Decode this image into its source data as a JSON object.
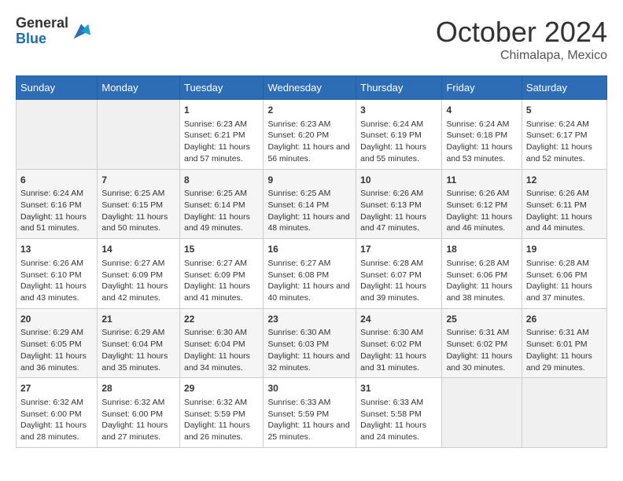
{
  "logo": {
    "general": "General",
    "blue": "Blue"
  },
  "title": "October 2024",
  "subtitle": "Chimalapa, Mexico",
  "days_of_week": [
    "Sunday",
    "Monday",
    "Tuesday",
    "Wednesday",
    "Thursday",
    "Friday",
    "Saturday"
  ],
  "weeks": [
    [
      {
        "day": "",
        "sunrise": "",
        "sunset": "",
        "daylight": ""
      },
      {
        "day": "",
        "sunrise": "",
        "sunset": "",
        "daylight": ""
      },
      {
        "day": "1",
        "sunrise": "Sunrise: 6:23 AM",
        "sunset": "Sunset: 6:21 PM",
        "daylight": "Daylight: 11 hours and 57 minutes."
      },
      {
        "day": "2",
        "sunrise": "Sunrise: 6:23 AM",
        "sunset": "Sunset: 6:20 PM",
        "daylight": "Daylight: 11 hours and 56 minutes."
      },
      {
        "day": "3",
        "sunrise": "Sunrise: 6:24 AM",
        "sunset": "Sunset: 6:19 PM",
        "daylight": "Daylight: 11 hours and 55 minutes."
      },
      {
        "day": "4",
        "sunrise": "Sunrise: 6:24 AM",
        "sunset": "Sunset: 6:18 PM",
        "daylight": "Daylight: 11 hours and 53 minutes."
      },
      {
        "day": "5",
        "sunrise": "Sunrise: 6:24 AM",
        "sunset": "Sunset: 6:17 PM",
        "daylight": "Daylight: 11 hours and 52 minutes."
      }
    ],
    [
      {
        "day": "6",
        "sunrise": "Sunrise: 6:24 AM",
        "sunset": "Sunset: 6:16 PM",
        "daylight": "Daylight: 11 hours and 51 minutes."
      },
      {
        "day": "7",
        "sunrise": "Sunrise: 6:25 AM",
        "sunset": "Sunset: 6:15 PM",
        "daylight": "Daylight: 11 hours and 50 minutes."
      },
      {
        "day": "8",
        "sunrise": "Sunrise: 6:25 AM",
        "sunset": "Sunset: 6:14 PM",
        "daylight": "Daylight: 11 hours and 49 minutes."
      },
      {
        "day": "9",
        "sunrise": "Sunrise: 6:25 AM",
        "sunset": "Sunset: 6:14 PM",
        "daylight": "Daylight: 11 hours and 48 minutes."
      },
      {
        "day": "10",
        "sunrise": "Sunrise: 6:26 AM",
        "sunset": "Sunset: 6:13 PM",
        "daylight": "Daylight: 11 hours and 47 minutes."
      },
      {
        "day": "11",
        "sunrise": "Sunrise: 6:26 AM",
        "sunset": "Sunset: 6:12 PM",
        "daylight": "Daylight: 11 hours and 46 minutes."
      },
      {
        "day": "12",
        "sunrise": "Sunrise: 6:26 AM",
        "sunset": "Sunset: 6:11 PM",
        "daylight": "Daylight: 11 hours and 44 minutes."
      }
    ],
    [
      {
        "day": "13",
        "sunrise": "Sunrise: 6:26 AM",
        "sunset": "Sunset: 6:10 PM",
        "daylight": "Daylight: 11 hours and 43 minutes."
      },
      {
        "day": "14",
        "sunrise": "Sunrise: 6:27 AM",
        "sunset": "Sunset: 6:09 PM",
        "daylight": "Daylight: 11 hours and 42 minutes."
      },
      {
        "day": "15",
        "sunrise": "Sunrise: 6:27 AM",
        "sunset": "Sunset: 6:09 PM",
        "daylight": "Daylight: 11 hours and 41 minutes."
      },
      {
        "day": "16",
        "sunrise": "Sunrise: 6:27 AM",
        "sunset": "Sunset: 6:08 PM",
        "daylight": "Daylight: 11 hours and 40 minutes."
      },
      {
        "day": "17",
        "sunrise": "Sunrise: 6:28 AM",
        "sunset": "Sunset: 6:07 PM",
        "daylight": "Daylight: 11 hours and 39 minutes."
      },
      {
        "day": "18",
        "sunrise": "Sunrise: 6:28 AM",
        "sunset": "Sunset: 6:06 PM",
        "daylight": "Daylight: 11 hours and 38 minutes."
      },
      {
        "day": "19",
        "sunrise": "Sunrise: 6:28 AM",
        "sunset": "Sunset: 6:06 PM",
        "daylight": "Daylight: 11 hours and 37 minutes."
      }
    ],
    [
      {
        "day": "20",
        "sunrise": "Sunrise: 6:29 AM",
        "sunset": "Sunset: 6:05 PM",
        "daylight": "Daylight: 11 hours and 36 minutes."
      },
      {
        "day": "21",
        "sunrise": "Sunrise: 6:29 AM",
        "sunset": "Sunset: 6:04 PM",
        "daylight": "Daylight: 11 hours and 35 minutes."
      },
      {
        "day": "22",
        "sunrise": "Sunrise: 6:30 AM",
        "sunset": "Sunset: 6:04 PM",
        "daylight": "Daylight: 11 hours and 34 minutes."
      },
      {
        "day": "23",
        "sunrise": "Sunrise: 6:30 AM",
        "sunset": "Sunset: 6:03 PM",
        "daylight": "Daylight: 11 hours and 32 minutes."
      },
      {
        "day": "24",
        "sunrise": "Sunrise: 6:30 AM",
        "sunset": "Sunset: 6:02 PM",
        "daylight": "Daylight: 11 hours and 31 minutes."
      },
      {
        "day": "25",
        "sunrise": "Sunrise: 6:31 AM",
        "sunset": "Sunset: 6:02 PM",
        "daylight": "Daylight: 11 hours and 30 minutes."
      },
      {
        "day": "26",
        "sunrise": "Sunrise: 6:31 AM",
        "sunset": "Sunset: 6:01 PM",
        "daylight": "Daylight: 11 hours and 29 minutes."
      }
    ],
    [
      {
        "day": "27",
        "sunrise": "Sunrise: 6:32 AM",
        "sunset": "Sunset: 6:00 PM",
        "daylight": "Daylight: 11 hours and 28 minutes."
      },
      {
        "day": "28",
        "sunrise": "Sunrise: 6:32 AM",
        "sunset": "Sunset: 6:00 PM",
        "daylight": "Daylight: 11 hours and 27 minutes."
      },
      {
        "day": "29",
        "sunrise": "Sunrise: 6:32 AM",
        "sunset": "Sunset: 5:59 PM",
        "daylight": "Daylight: 11 hours and 26 minutes."
      },
      {
        "day": "30",
        "sunrise": "Sunrise: 6:33 AM",
        "sunset": "Sunset: 5:59 PM",
        "daylight": "Daylight: 11 hours and 25 minutes."
      },
      {
        "day": "31",
        "sunrise": "Sunrise: 6:33 AM",
        "sunset": "Sunset: 5:58 PM",
        "daylight": "Daylight: 11 hours and 24 minutes."
      },
      {
        "day": "",
        "sunrise": "",
        "sunset": "",
        "daylight": ""
      },
      {
        "day": "",
        "sunrise": "",
        "sunset": "",
        "daylight": ""
      }
    ]
  ]
}
